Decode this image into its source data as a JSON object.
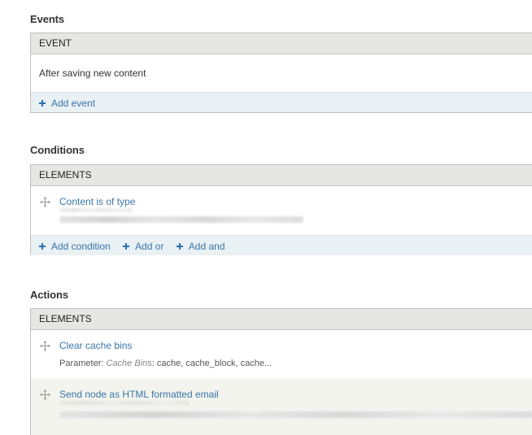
{
  "events": {
    "title": "Events",
    "header": "EVENT",
    "item": "After saving new content",
    "add_event": "Add event"
  },
  "conditions": {
    "title": "Conditions",
    "header": "ELEMENTS",
    "item_link": "Content is of type",
    "add_condition": "Add condition",
    "add_or": "Add or",
    "add_and": "Add and"
  },
  "actions": {
    "title": "Actions",
    "header": "ELEMENTS",
    "items": [
      {
        "link": "Clear cache bins",
        "param_prefix": "Parameter:",
        "param_label": "Cache Bins",
        "param_value": ": cache, cache_block, cache..."
      },
      {
        "link": "Send node as HTML formatted email"
      }
    ]
  }
}
